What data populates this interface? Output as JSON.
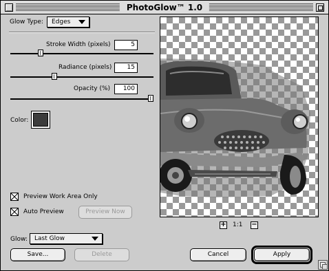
{
  "window": {
    "title": "PhotoGlow™ 1.0"
  },
  "glow_type": {
    "label": "Glow Type:",
    "value": "Edges"
  },
  "stroke_width": {
    "label": "Stroke Width (pixels)",
    "value": "5",
    "level": 0.2
  },
  "radiance": {
    "label": "Radiance (pixels)",
    "value": "15",
    "level": 0.3
  },
  "opacity": {
    "label": "Opacity (%)",
    "value": "100",
    "level": 1.0
  },
  "color": {
    "label": "Color:",
    "swatch": "#3c3c3c"
  },
  "preview_work_area": {
    "label": "Preview Work Area Only",
    "checked": true
  },
  "auto_preview": {
    "label": "Auto Preview",
    "checked": true
  },
  "preview_now": {
    "label": "Preview Now"
  },
  "zoom": {
    "level": "1:1",
    "zoom_in_icon": "plus-icon",
    "zoom_out_icon": "minus-icon"
  },
  "glow_preset": {
    "label": "Glow:",
    "value": "Last Glow"
  },
  "buttons": {
    "save": "Save...",
    "delete": "Delete",
    "cancel": "Cancel",
    "apply": "Apply"
  }
}
